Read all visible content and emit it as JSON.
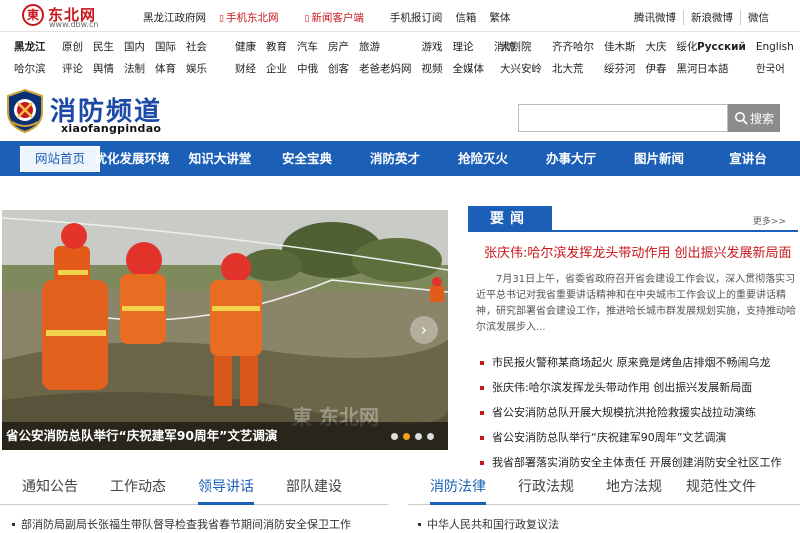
{
  "topbar": {
    "logo_mark": "東",
    "logo_name": "东北网",
    "logo_url": "www.dbw.cn",
    "links": [
      {
        "label": "黑龙江政府网",
        "red": false,
        "icon": ""
      },
      {
        "label": "手机东北网",
        "red": true,
        "icon": "phone-icon"
      },
      {
        "label": "新闻客户端",
        "red": true,
        "icon": "phone-icon"
      },
      {
        "label": "手机报订阅",
        "red": false,
        "icon": ""
      },
      {
        "label": "信箱",
        "red": false,
        "icon": ""
      },
      {
        "label": "繁体",
        "red": false,
        "icon": ""
      }
    ],
    "social": [
      "腾讯微博",
      "新浪微博",
      "微信"
    ]
  },
  "subnav": {
    "region": [
      "黑龙江",
      "哈尔滨"
    ],
    "group1": [
      "原创",
      "民生",
      "国内",
      "国际",
      "社会",
      "评论",
      "舆情",
      "法制",
      "体育",
      "娱乐"
    ],
    "group2": [
      "健康",
      "教育",
      "汽车",
      "房产",
      "旅游",
      "游戏",
      "理论",
      "消防",
      "财经",
      "企业",
      "中俄",
      "创客",
      "老爸老妈网",
      "视频",
      "全媒体"
    ],
    "group3": [
      "大剧院",
      "齐齐哈尔",
      "佳木斯",
      "大庆",
      "绥化",
      "大兴安岭",
      "北大荒",
      "绥芬河",
      "伊春",
      "黑河"
    ],
    "languages": [
      "Русский",
      "English",
      "日本語",
      "한국어"
    ]
  },
  "brand": {
    "title": "消防频道",
    "pinyin": "xiaofangpindao",
    "emblem_icon": "fire-rescue-emblem-icon"
  },
  "search": {
    "placeholder": "",
    "button_label": "搜索",
    "icon": "search-icon"
  },
  "mainnav": [
    "网站首页",
    "优化发展环境",
    "知识大讲堂",
    "安全宝典",
    "消防英才",
    "抢险灭火",
    "办事大厅",
    "图片新闻",
    "宣讲台"
  ],
  "slider": {
    "caption": "省公安消防总队举行“庆祝建军90周年”文艺调演",
    "watermark": "東 东北网",
    "slide_count": 4,
    "active_slide": 2
  },
  "news": {
    "tab_label": "要闻",
    "more_label": "更多>>",
    "headline": "张庆伟:哈尔滨发挥龙头带动作用 创出振兴发展新局面",
    "summary": "7月31日上午，省委省政府召开省会建设工作会议，深入贯彻落实习近平总书记对我省重要讲话精神和在中央城市工作会议上的重要讲话精神，研究部署省会建设工作，推进哈长城市群发展规划实施，支持推动哈尔滨发展步入...",
    "items": [
      "市民报火警称某商场起火 原来竟是烤鱼店排烟不畅闹乌龙",
      "张庆伟:哈尔滨发挥龙头带动作用 创出振兴发展新局面",
      "省公安消防总队开展大规模抗洪抢险救援实战拉动演练",
      "省公安消防总队举行“庆祝建军90周年”文艺调演",
      "我省部署落实消防安全主体责任 开展创建消防安全社区工作"
    ]
  },
  "tabsA": {
    "tabs": [
      "通知公告",
      "工作动态",
      "领导讲话",
      "部队建设"
    ],
    "active": 2,
    "first_item": "部消防局副局长张福生带队督导检查我省春节期间消防安全保卫工作"
  },
  "tabsB": {
    "tabs": [
      "消防法律",
      "行政法规",
      "地方法规",
      "规范性文件"
    ],
    "active": 0,
    "first_item": "中华人民共和国行政复议法"
  }
}
